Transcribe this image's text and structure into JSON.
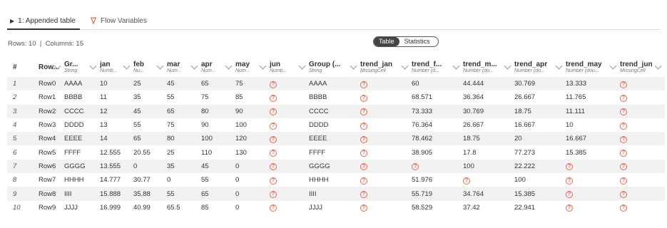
{
  "tabs": [
    {
      "label": "1: Appended table",
      "icon": "play-triangle-icon"
    },
    {
      "label": "Flow Variables",
      "icon": "flow-variable-icon"
    }
  ],
  "info": {
    "rows": "Rows: 10",
    "separator": "|",
    "columns": "Columns: 15"
  },
  "view_toggle": {
    "table": "Table",
    "statistics": "Statistics",
    "selected": "Table"
  },
  "table": {
    "index_header": "#",
    "columns": [
      {
        "name": "Row...",
        "type": ""
      },
      {
        "name": "Gr...",
        "type": "String"
      },
      {
        "name": "jan",
        "type": "Numb..."
      },
      {
        "name": "feb",
        "type": "Nu..."
      },
      {
        "name": "mar",
        "type": "Num..."
      },
      {
        "name": "apr",
        "type": "Num..."
      },
      {
        "name": "may",
        "type": "Num..."
      },
      {
        "name": "jun",
        "type": "Numb..."
      },
      {
        "name": "Group (...",
        "type": "String"
      },
      {
        "name": "trend_jan",
        "type": "MissingCell"
      },
      {
        "name": "trend_f...",
        "type": "Number (d..."
      },
      {
        "name": "trend_m...",
        "type": "Number (do..."
      },
      {
        "name": "trend_apr",
        "type": "Number (do..."
      },
      {
        "name": "trend_may",
        "type": "Number (dou..."
      },
      {
        "name": "trend_jun",
        "type": "MissingCell"
      }
    ],
    "rows": [
      [
        "1",
        "Row0",
        "AAAA",
        "10",
        "25",
        "45",
        "65",
        "75",
        "?",
        "AAAA",
        "?",
        "60",
        "44.444",
        "30.769",
        "13.333",
        "?"
      ],
      [
        "2",
        "Row1",
        "BBBB",
        "11",
        "35",
        "55",
        "75",
        "85",
        "?",
        "BBBB",
        "?",
        "68.571",
        "36.364",
        "26.667",
        "11.765",
        "?"
      ],
      [
        "3",
        "Row2",
        "CCCC",
        "12",
        "45",
        "65",
        "80",
        "90",
        "?",
        "CCCC",
        "?",
        "73.333",
        "30.769",
        "18.75",
        "11.111",
        "?"
      ],
      [
        "4",
        "Row3",
        "DDDD",
        "13",
        "55",
        "75",
        "90",
        "100",
        "?",
        "DDDD",
        "?",
        "76.364",
        "26.667",
        "16.667",
        "10",
        "?"
      ],
      [
        "5",
        "Row4",
        "EEEE",
        "14",
        "65",
        "80",
        "100",
        "120",
        "?",
        "EEEE",
        "?",
        "78.462",
        "18.75",
        "20",
        "16.667",
        "?"
      ],
      [
        "6",
        "Row5",
        "FFFF",
        "12.555",
        "20.55",
        "25",
        "110",
        "130",
        "?",
        "FFFF",
        "?",
        "38.905",
        "17.8",
        "77.273",
        "15.385",
        "?"
      ],
      [
        "7",
        "Row6",
        "GGGG",
        "13.555",
        "0",
        "35",
        "45",
        "0",
        "?",
        "GGGG",
        "?",
        "?",
        "100",
        "22.222",
        "?",
        "?"
      ],
      [
        "8",
        "Row7",
        "HHHH",
        "14.777",
        "30.77",
        "0",
        "55",
        "0",
        "?",
        "HHHH",
        "?",
        "51.976",
        "?",
        "100",
        "?",
        "?"
      ],
      [
        "9",
        "Row8",
        "IIII",
        "15.888",
        "35.88",
        "55",
        "65",
        "0",
        "?",
        "IIII",
        "?",
        "55.719",
        "34.764",
        "15.385",
        "?",
        "?"
      ],
      [
        "10",
        "Row9",
        "JJJJ",
        "16.999",
        "40.99",
        "65.5",
        "85",
        "0",
        "?",
        "JJJJ",
        "?",
        "58.529",
        "37.42",
        "22.941",
        "?",
        "?"
      ]
    ]
  },
  "colors": {
    "missing": "#e8694f",
    "stripe": "#f2f2f2",
    "accent": "#333333"
  }
}
